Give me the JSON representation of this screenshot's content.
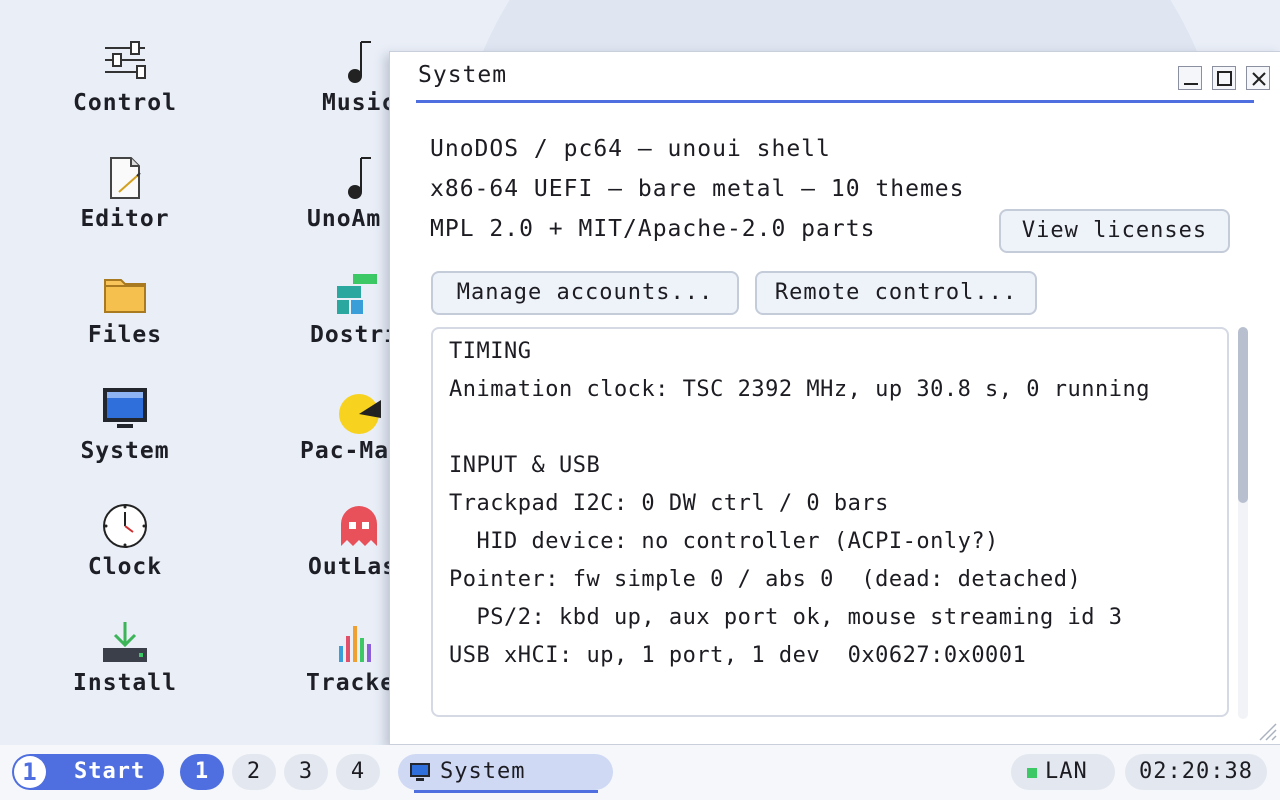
{
  "desktop": {
    "icons": [
      {
        "label": "Control",
        "icon": "sliders-icon"
      },
      {
        "label": "Editor",
        "icon": "document-pen-icon"
      },
      {
        "label": "Files",
        "icon": "folder-icon"
      },
      {
        "label": "System",
        "icon": "monitor-icon"
      },
      {
        "label": "Clock",
        "icon": "clock-icon"
      },
      {
        "label": "Install",
        "icon": "download-drive-icon"
      },
      {
        "label": "Music",
        "icon": "music-note-icon"
      },
      {
        "label": "UnoAm",
        "icon": "music-note-icon"
      },
      {
        "label": "Dostri",
        "icon": "falling-blocks-icon"
      },
      {
        "label": "Pac-Ma",
        "icon": "pacman-icon"
      },
      {
        "label": "OutLas",
        "icon": "ghost-icon"
      },
      {
        "label": "Tracke",
        "icon": "equalizer-bars-icon"
      }
    ]
  },
  "window": {
    "title": "System",
    "info": {
      "line1": "UnoDOS / pc64  –  unoui shell",
      "line2": "x86-64 UEFI  –  bare metal  –  10 themes",
      "line3": "MPL 2.0 + MIT/Apache-2.0 parts"
    },
    "buttons": {
      "view_licenses": "View licenses",
      "manage_accounts": "Manage accounts...",
      "remote_control": "Remote control..."
    },
    "text_lines": [
      "TIMING",
      "Animation clock: TSC 2392 MHz, up 30.8 s, 0 running",
      "",
      "INPUT & USB",
      "Trackpad I2C: 0 DW ctrl / 0 bars",
      "  HID device: no controller (ACPI-only?)",
      "Pointer: fw simple 0 / abs 0  (dead: detached)",
      "  PS/2: kbd up, aux port ok, mouse streaming id 3",
      "USB xHCI: up, 1 port, 1 dev  0x0627:0x0001"
    ],
    "scroll_fraction": 0.45
  },
  "taskbar": {
    "start_number": "1",
    "start_label": "Start",
    "workspaces": [
      "1",
      "2",
      "3",
      "4"
    ],
    "active_workspace": "1",
    "task_label": "System",
    "network_label": "LAN",
    "clock": "02:20:38"
  },
  "colors": {
    "accent": "#4f6fe0",
    "desktop_bg": "#e9eef7",
    "network_ok": "#3cc864"
  }
}
